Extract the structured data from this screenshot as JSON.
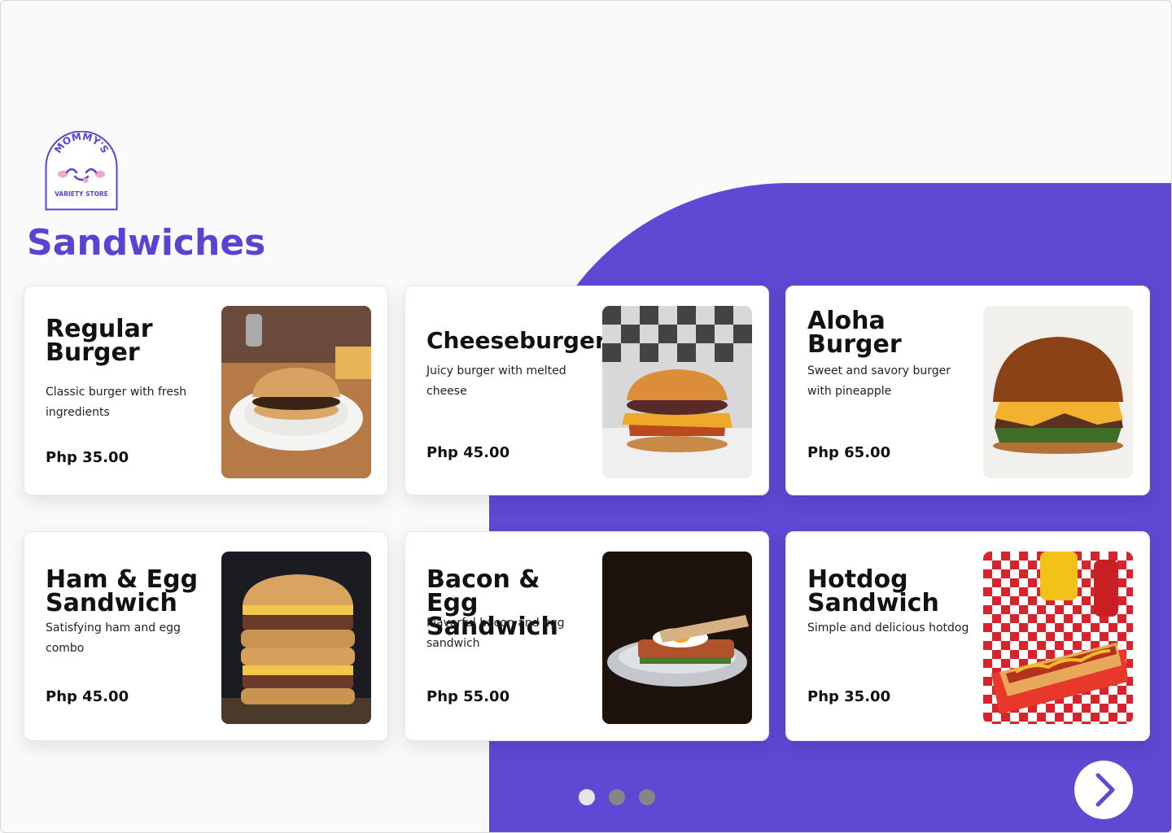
{
  "brand": {
    "logo_line1": "MOMMY'S",
    "logo_line2": "VARIETY STORE",
    "logo_color": "#5a43d2",
    "logo_icon": "smiley-face-icon"
  },
  "page": {
    "title": "Sandwiches",
    "accent_color": "#5e48d4"
  },
  "menu_items": [
    {
      "name": "Regular Burger",
      "description": "Classic burger with fresh ingredients",
      "price": "Php 35.00",
      "image": "regular-burger-photo"
    },
    {
      "name": "Cheeseburger",
      "description": "Juicy burger with melted cheese",
      "price": "Php 45.00",
      "image": "cheeseburger-photo"
    },
    {
      "name": "Aloha Burger",
      "description": "Sweet and savory burger with pineapple",
      "price": "Php 65.00",
      "image": "aloha-burger-photo"
    },
    {
      "name": "Ham & Egg Sandwich",
      "description": "Satisfying ham and egg combo",
      "price": "Php 45.00",
      "image": "ham-egg-sandwich-photo"
    },
    {
      "name": "Bacon & Egg Sandwich",
      "description": "Flavorful bacon and egg sandwich",
      "price": "Php 55.00",
      "image": "bacon-egg-sandwich-photo"
    },
    {
      "name": "Hotdog Sandwich",
      "description": "Simple and delicious hotdog",
      "price": "Php 35.00",
      "image": "hotdog-sandwich-photo"
    }
  ],
  "pagination": {
    "current_page": 1,
    "total_pages": 3,
    "next_icon": "chevron-right-icon"
  }
}
